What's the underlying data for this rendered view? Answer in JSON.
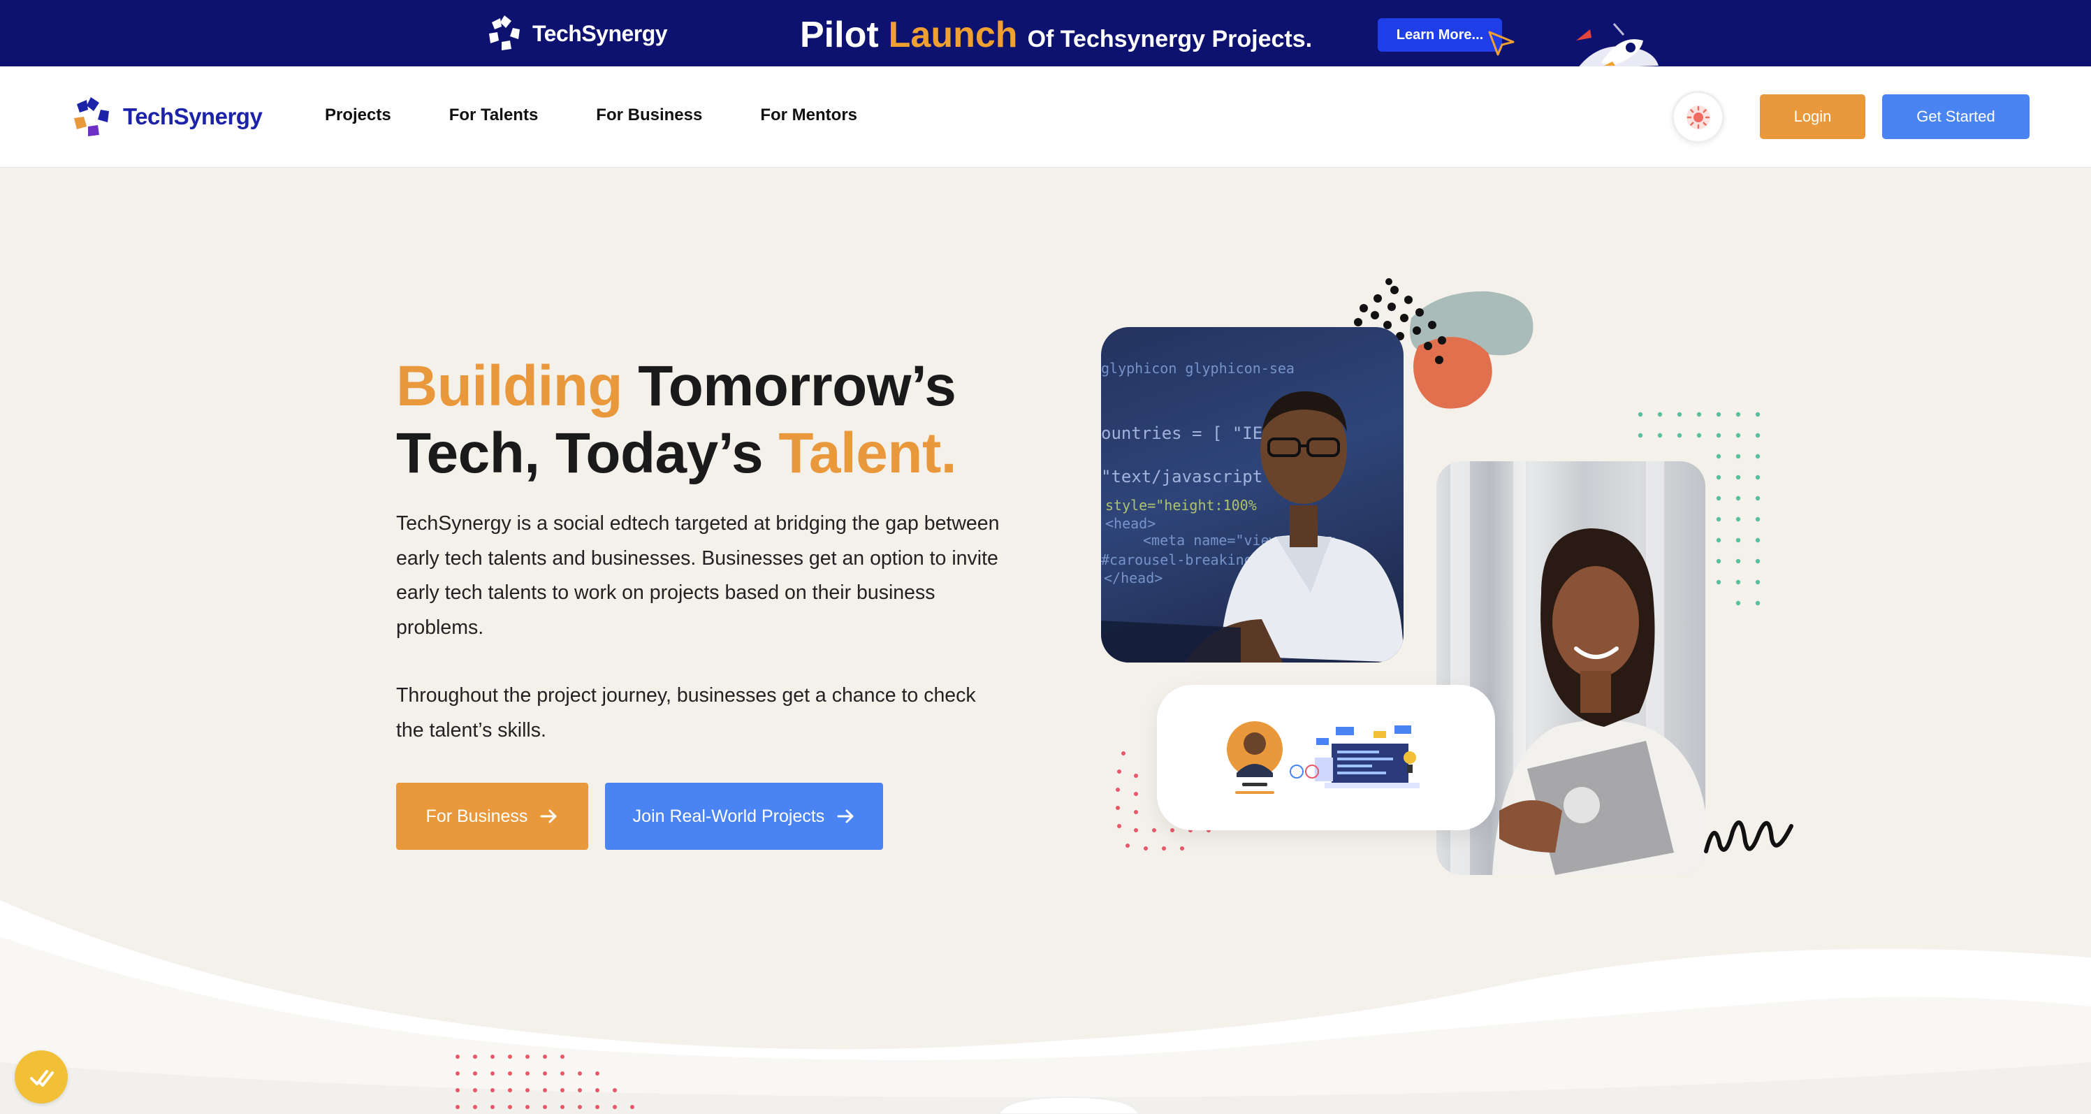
{
  "banner": {
    "logo_text": "TechSynergy",
    "headline_part1": "Pilot",
    "headline_part2": "Launch",
    "headline_part3": "Of Techsynergy Projects.",
    "button_label": "Learn More..."
  },
  "nav": {
    "logo_text": "TechSynergy",
    "links": [
      {
        "label": "Projects"
      },
      {
        "label": "For Talents"
      },
      {
        "label": "For Business"
      },
      {
        "label": "For Mentors"
      }
    ],
    "login_label": "Login",
    "get_started_label": "Get Started"
  },
  "hero": {
    "title_w1": "Building",
    "title_w2": "Tomorrow’s",
    "title_w3": "Tech, Today’s",
    "title_w4": "Talent.",
    "paragraph1": "TechSynergy is a social edtech targeted at bridging the gap between early tech talents and businesses. Businesses get an option to invite early tech talents to work on projects based on their business problems.",
    "paragraph2": "Throughout the project journey, businesses get a chance to check the talent’s skills.",
    "cta_business": "For Business",
    "cta_projects": "Join Real-World Projects"
  },
  "icons": {
    "arrow": "arrow-right-icon",
    "theme": "sun-icon",
    "chat": "chat-check-icon"
  },
  "colors": {
    "banner_bg": "#0d1270",
    "accent_orange": "#e9993b",
    "accent_blue": "#4a84f2",
    "page_bg": "#f4f1eb",
    "brand_navy": "#1d23a8"
  }
}
